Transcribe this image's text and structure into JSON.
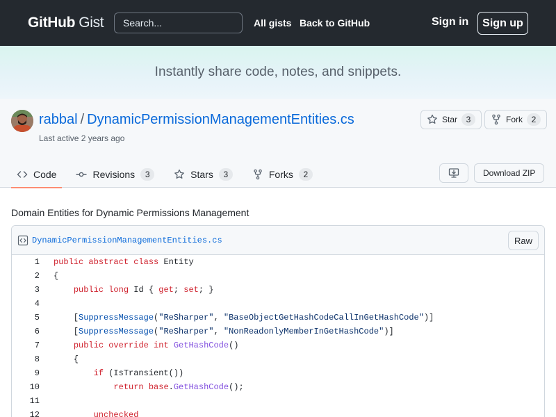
{
  "header": {
    "logo_primary": "GitHub",
    "logo_secondary": "Gist",
    "search_placeholder": "Search...",
    "nav_all_gists": "All gists",
    "nav_back": "Back to GitHub",
    "sign_in": "Sign in",
    "sign_up": "Sign up"
  },
  "hero": {
    "tagline": "Instantly share code, notes, and snippets."
  },
  "gist": {
    "owner": "rabbal",
    "separator": "/",
    "name": "DynamicPermissionManagementEntities.cs",
    "last_active": "Last active 2 years ago",
    "star_label": "Star",
    "star_count": "3",
    "fork_label": "Fork",
    "fork_count": "2",
    "download_zip": "Download ZIP",
    "description": "Domain Entities for Dynamic Permissions Management"
  },
  "tabs": [
    {
      "label": "Code",
      "icon": "code-icon",
      "count": ""
    },
    {
      "label": "Revisions",
      "icon": "commit-icon",
      "count": "3"
    },
    {
      "label": "Stars",
      "icon": "star-icon",
      "count": "3"
    },
    {
      "label": "Forks",
      "icon": "fork-icon",
      "count": "2"
    }
  ],
  "file": {
    "name": "DynamicPermissionManagementEntities.cs",
    "raw_label": "Raw",
    "lines": [
      {
        "n": "1",
        "text": "public abstract class Entity"
      },
      {
        "n": "2",
        "text": "{"
      },
      {
        "n": "3",
        "text": "    public long Id { get; set; }"
      },
      {
        "n": "4",
        "text": ""
      },
      {
        "n": "5",
        "text": "    [SuppressMessage(\"ReSharper\", \"BaseObjectGetHashCodeCallInGetHashCode\")]"
      },
      {
        "n": "6",
        "text": "    [SuppressMessage(\"ReSharper\", \"NonReadonlyMemberInGetHashCode\")]"
      },
      {
        "n": "7",
        "text": "    public override int GetHashCode()"
      },
      {
        "n": "8",
        "text": "    {"
      },
      {
        "n": "9",
        "text": "        if (IsTransient())"
      },
      {
        "n": "10",
        "text": "            return base.GetHashCode();"
      },
      {
        "n": "11",
        "text": ""
      },
      {
        "n": "12",
        "text": "        unchecked"
      }
    ]
  },
  "colors": {
    "header_bg": "#24292f",
    "link": "#0969da",
    "keyword": "#cf222e",
    "function": "#8250df",
    "string": "#0a3069",
    "active_tab_underline": "#fd8c73"
  }
}
